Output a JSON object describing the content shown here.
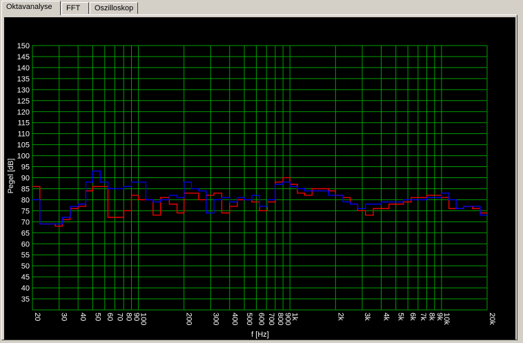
{
  "tabs": [
    {
      "label": "Oktavanalyse",
      "active": true
    },
    {
      "label": "FFT",
      "active": false
    },
    {
      "label": "Oszilloskop",
      "active": false
    }
  ],
  "colors": {
    "background": "#000000",
    "grid": "#00a000",
    "series_red": "#ff0000",
    "series_blue": "#0000ff",
    "text": "#ffffff"
  },
  "chart_data": {
    "type": "line",
    "title": "",
    "xlabel": "f [Hz]",
    "ylabel": "Pegel [dB]",
    "xscale": "log",
    "xlim": [
      20,
      20000
    ],
    "ylim": [
      30,
      150
    ],
    "grid": true,
    "y_ticks": [
      35,
      40,
      45,
      50,
      55,
      60,
      65,
      70,
      75,
      80,
      85,
      90,
      95,
      100,
      105,
      110,
      115,
      120,
      125,
      130,
      135,
      140,
      145,
      150
    ],
    "x_ticks": [
      {
        "value": 20,
        "label": "20"
      },
      {
        "value": 30,
        "label": "30"
      },
      {
        "value": 40,
        "label": "40"
      },
      {
        "value": 50,
        "label": "50"
      },
      {
        "value": 60,
        "label": "60"
      },
      {
        "value": 70,
        "label": "70"
      },
      {
        "value": 80,
        "label": "80"
      },
      {
        "value": 90,
        "label": "90"
      },
      {
        "value": 100,
        "label": "100"
      },
      {
        "value": 200,
        "label": "200"
      },
      {
        "value": 300,
        "label": "300"
      },
      {
        "value": 400,
        "label": "400"
      },
      {
        "value": 500,
        "label": "500"
      },
      {
        "value": 600,
        "label": "600"
      },
      {
        "value": 700,
        "label": "700"
      },
      {
        "value": 800,
        "label": "800"
      },
      {
        "value": 900,
        "label": "900"
      },
      {
        "value": 1000,
        "label": "1k"
      },
      {
        "value": 2000,
        "label": "2k"
      },
      {
        "value": 3000,
        "label": "3k"
      },
      {
        "value": 4000,
        "label": "4k"
      },
      {
        "value": 5000,
        "label": "5k"
      },
      {
        "value": 6000,
        "label": "6k"
      },
      {
        "value": 7000,
        "label": "7k"
      },
      {
        "value": 8000,
        "label": "8k"
      },
      {
        "value": 9000,
        "label": "9k"
      },
      {
        "value": 10000,
        "label": "10k"
      },
      {
        "value": 20000,
        "label": "20k"
      }
    ],
    "x_edges": [
      20,
      22.4,
      25,
      28.3,
      31.5,
      35.5,
      40,
      45,
      50,
      56,
      63,
      71,
      80,
      90,
      100,
      112,
      125,
      140,
      160,
      180,
      200,
      224,
      250,
      280,
      315,
      355,
      400,
      450,
      500,
      560,
      630,
      710,
      800,
      900,
      1000,
      1120,
      1250,
      1400,
      1600,
      1800,
      2000,
      2240,
      2500,
      2800,
      3150,
      3550,
      4000,
      4500,
      5000,
      5600,
      6300,
      7100,
      8000,
      9000,
      10000,
      11200,
      12500,
      14000,
      16000,
      18000,
      20000
    ],
    "series": [
      {
        "name": "",
        "color": "#ff0000",
        "values": [
          86,
          69,
          69,
          68,
          71,
          76,
          77,
          84,
          86,
          86,
          72,
          72,
          75,
          82,
          80,
          80,
          73,
          81,
          78,
          74,
          83,
          83,
          80,
          82,
          83,
          74,
          77,
          80,
          80,
          79,
          75,
          79,
          88,
          90,
          87,
          83,
          82,
          85,
          85,
          84,
          82,
          81,
          78,
          75,
          73,
          76,
          76,
          78,
          78,
          79,
          81,
          81,
          82,
          82,
          81,
          76,
          76,
          77,
          76,
          74
        ]
      },
      {
        "name": "",
        "color": "#0000ff",
        "values": [
          80,
          69,
          69,
          69,
          72,
          77,
          78,
          88,
          93,
          88,
          85,
          85,
          86,
          88,
          88,
          80,
          79,
          80,
          82,
          81,
          88,
          85,
          84,
          74,
          80,
          81,
          79,
          81,
          80,
          82,
          77,
          80,
          87,
          88,
          86,
          85,
          84,
          84,
          84,
          82,
          82,
          79,
          78,
          76,
          78,
          78,
          79,
          79,
          79,
          80,
          80,
          80,
          81,
          81,
          83,
          80,
          76,
          77,
          77,
          73
        ]
      }
    ]
  }
}
